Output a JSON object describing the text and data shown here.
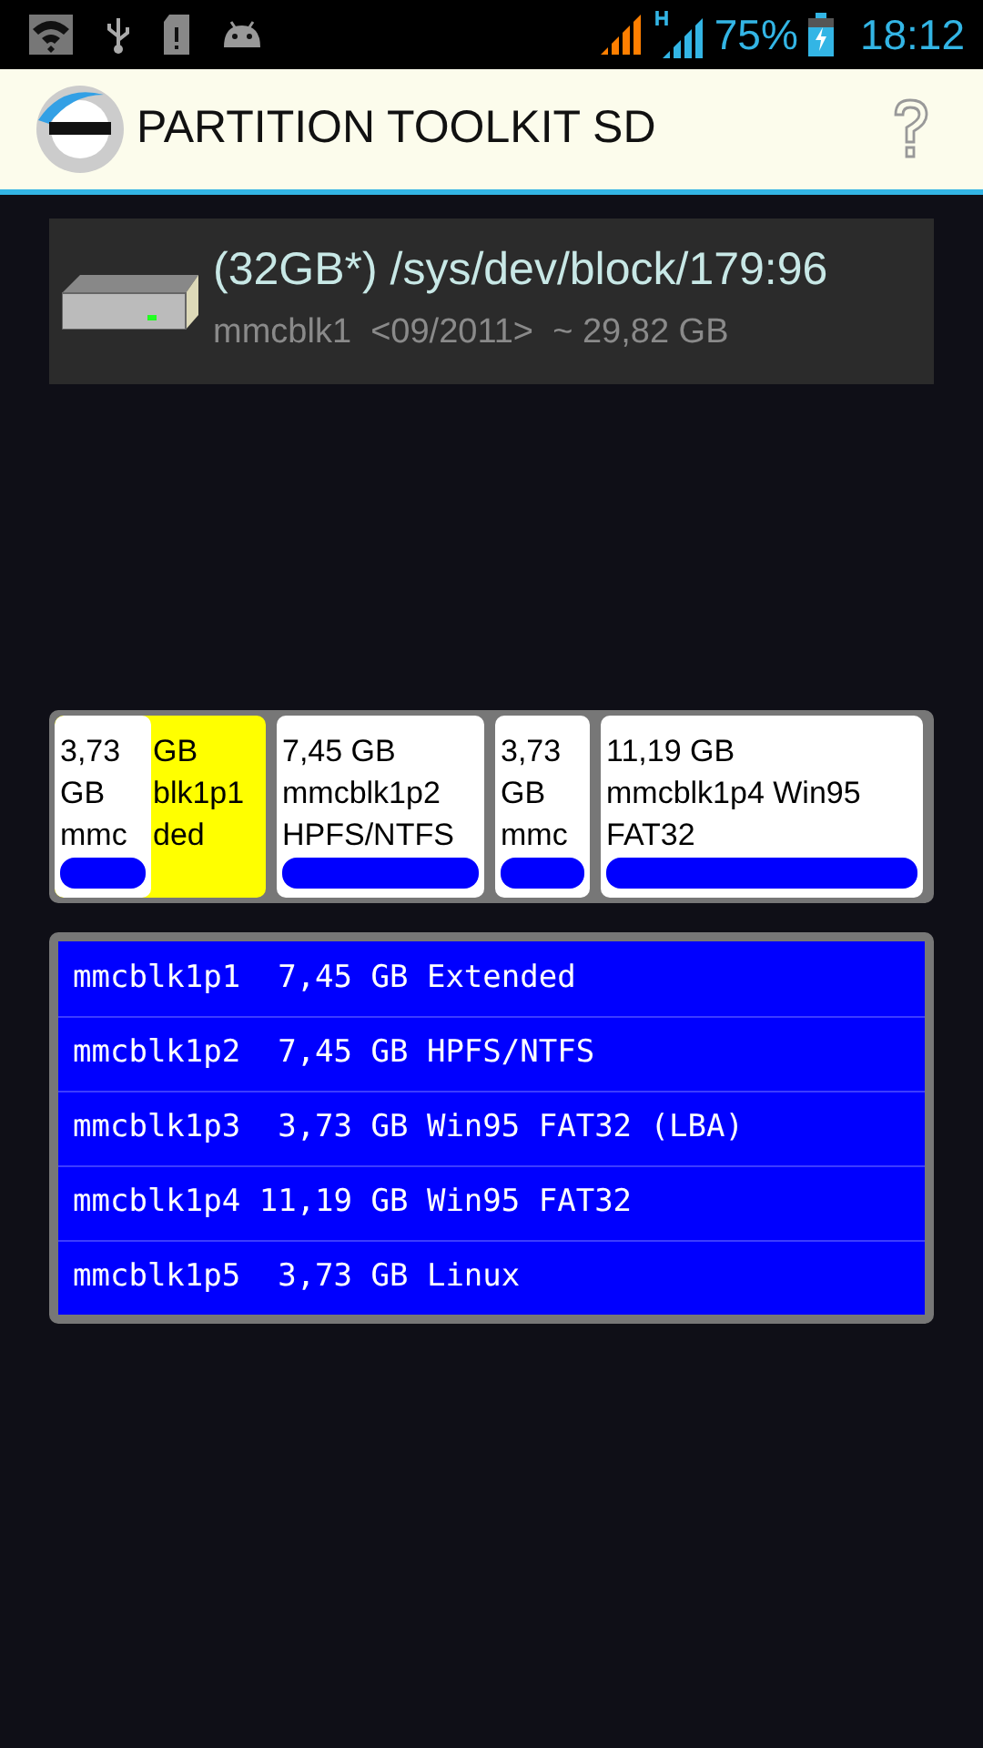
{
  "status_bar": {
    "battery": "75%",
    "time": "18:12"
  },
  "app_bar": {
    "title": "PARTITION TOOLKIT SD"
  },
  "device": {
    "title": "(32GB*) /sys/dev/block/179:96",
    "subtitle": "mmcblk1  <09/2011>  ~ 29,82 GB"
  },
  "partition_map": [
    {
      "kind": "extended",
      "lines": [
        "GB",
        "blk1p1",
        "ded"
      ],
      "logical": {
        "lines": [
          "3,73",
          "GB",
          "mmc"
        ]
      }
    },
    {
      "kind": "primary",
      "lines": [
        "7,45 GB",
        "mmcblk1p2",
        "HPFS/NTFS"
      ]
    },
    {
      "kind": "primary",
      "lines": [
        "3,73",
        "GB",
        "mmc"
      ]
    },
    {
      "kind": "primary",
      "lines": [
        "11,19 GB",
        "mmcblk1p4 Win95",
        "FAT32"
      ]
    }
  ],
  "partition_list": [
    {
      "line": "mmcblk1p1  7,45 GB Extended"
    },
    {
      "line": "mmcblk1p2  7,45 GB HPFS/NTFS"
    },
    {
      "line": "mmcblk1p3  3,73 GB Win95 FAT32 (LBA)"
    },
    {
      "line": "mmcblk1p4 11,19 GB Win95 FAT32"
    },
    {
      "line": "mmcblk1p5  3,73 GB Linux"
    }
  ]
}
